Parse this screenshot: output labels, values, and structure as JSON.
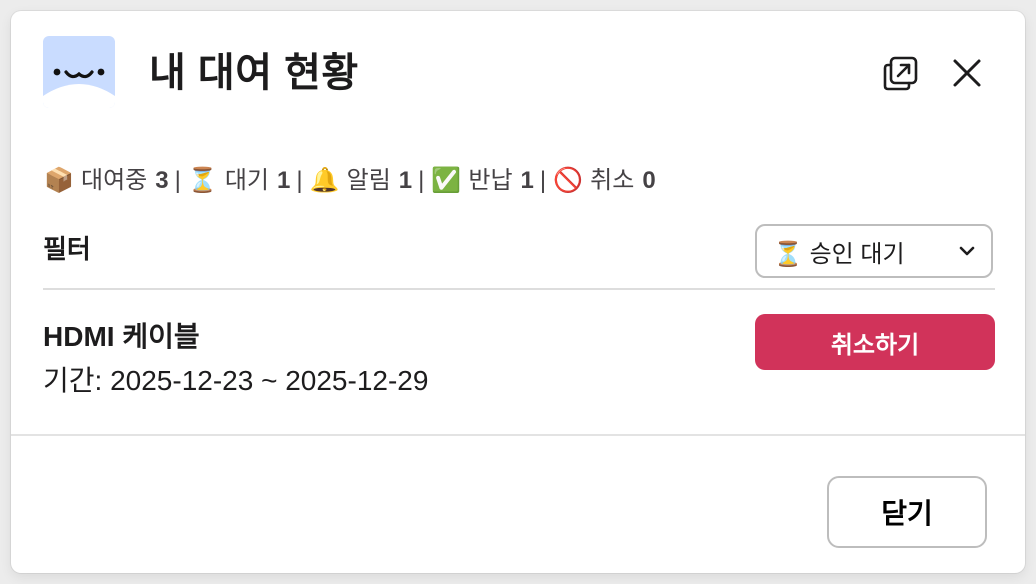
{
  "modal": {
    "title": "내 대여 현황"
  },
  "status": {
    "items": [
      {
        "emoji": "📦",
        "label": "대여중",
        "count": "3"
      },
      {
        "emoji": "⏳",
        "label": "대기",
        "count": "1"
      },
      {
        "emoji": "🔔",
        "label": "알림",
        "count": "1"
      },
      {
        "emoji": "✅",
        "label": "반납",
        "count": "1"
      },
      {
        "emoji": "🚫",
        "label": "취소",
        "count": "0"
      }
    ],
    "separator": "|"
  },
  "filter": {
    "label": "필터",
    "selected_emoji": "⏳",
    "selected_value": "승인 대기"
  },
  "rental": {
    "name": "HDMI 케이블",
    "period": "기간: 2025-12-23 ~ 2025-12-29",
    "cancel_label": "취소하기"
  },
  "footer": {
    "close_label": "닫기"
  },
  "icons": {
    "open": "open-in-window-icon",
    "close": "close-icon",
    "dropdown": "chevron-down-icon"
  },
  "colors": {
    "accent_danger": "#d1335a",
    "avatar_bg": "#c9dcff"
  }
}
